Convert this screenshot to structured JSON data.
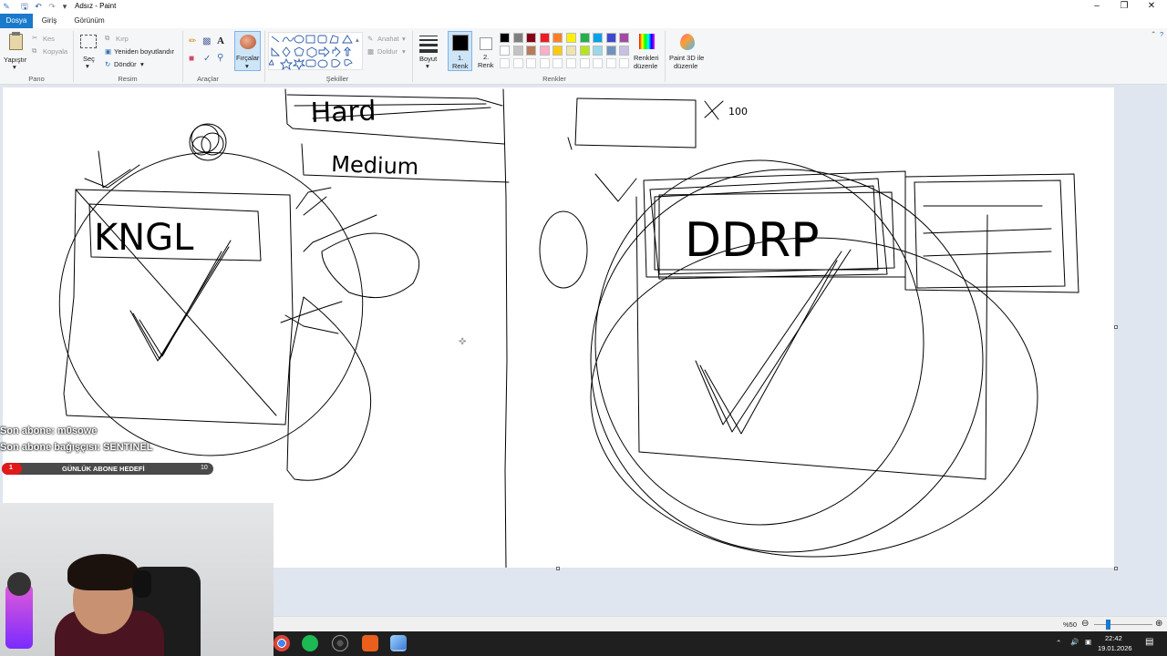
{
  "window": {
    "title": "Adsız - Paint"
  },
  "tabs": [
    {
      "label": "Dosya"
    },
    {
      "label": "Giriş"
    },
    {
      "label": "Görünüm"
    }
  ],
  "ribbon": {
    "pano": {
      "label": "Pano",
      "paste": "Yapıştır",
      "cut": "Kes",
      "copy": "Kopyala"
    },
    "resim": {
      "label": "Resim",
      "select": "Seç",
      "crop": "Kırp",
      "resize": "Yeniden boyutlandır",
      "rotate": "Döndür"
    },
    "araclar": {
      "label": "Araçlar"
    },
    "fircalar": {
      "label": "Fırçalar"
    },
    "sekiller": {
      "label": "Şekiller",
      "outline": "Anahat",
      "fill": "Doldur"
    },
    "boyut": {
      "label": "Boyut"
    },
    "renkler": {
      "label": "Renkler",
      "color1": "1.\nRenk",
      "color1_a": "1.",
      "color1_b": "Renk",
      "color2_a": "2.",
      "color2_b": "Renk",
      "edit_a": "Renkleri",
      "edit_b": "düzenle",
      "palette_row1": [
        "#000000",
        "#7f7f7f",
        "#880015",
        "#ed1c24",
        "#ff7f27",
        "#fff200",
        "#22b14c",
        "#00a2e8",
        "#3f48cc",
        "#a349a4"
      ],
      "palette_row2": [
        "#ffffff",
        "#c3c3c3",
        "#b97a57",
        "#ffaec9",
        "#ffc90e",
        "#efe4b0",
        "#b5e61d",
        "#99d9ea",
        "#7092be",
        "#c8bfe7"
      ],
      "color1_value": "#000000",
      "color2_value": "#ffffff"
    },
    "paint3d": {
      "a": "Paint 3D ile",
      "b": "düzenle"
    }
  },
  "canvas_text": {
    "hard": "Hard",
    "medium": "Medium",
    "kngl": "KNGL",
    "ddrp": "DDRP",
    "num": "100"
  },
  "status": {
    "zoom": "%50"
  },
  "taskbar": {
    "time": "22:42",
    "date": "19.01.2026"
  },
  "stream_overlay": {
    "last_sub": "Son abone: m0sowe",
    "last_sub_gift": "Son abone bağışçısı: SENTINEL",
    "goal_label": "GÜNLÜK ABONE HEDEFİ",
    "goal_current": "1",
    "goal_target": "10",
    "goal_accent": "#e01a1a"
  }
}
